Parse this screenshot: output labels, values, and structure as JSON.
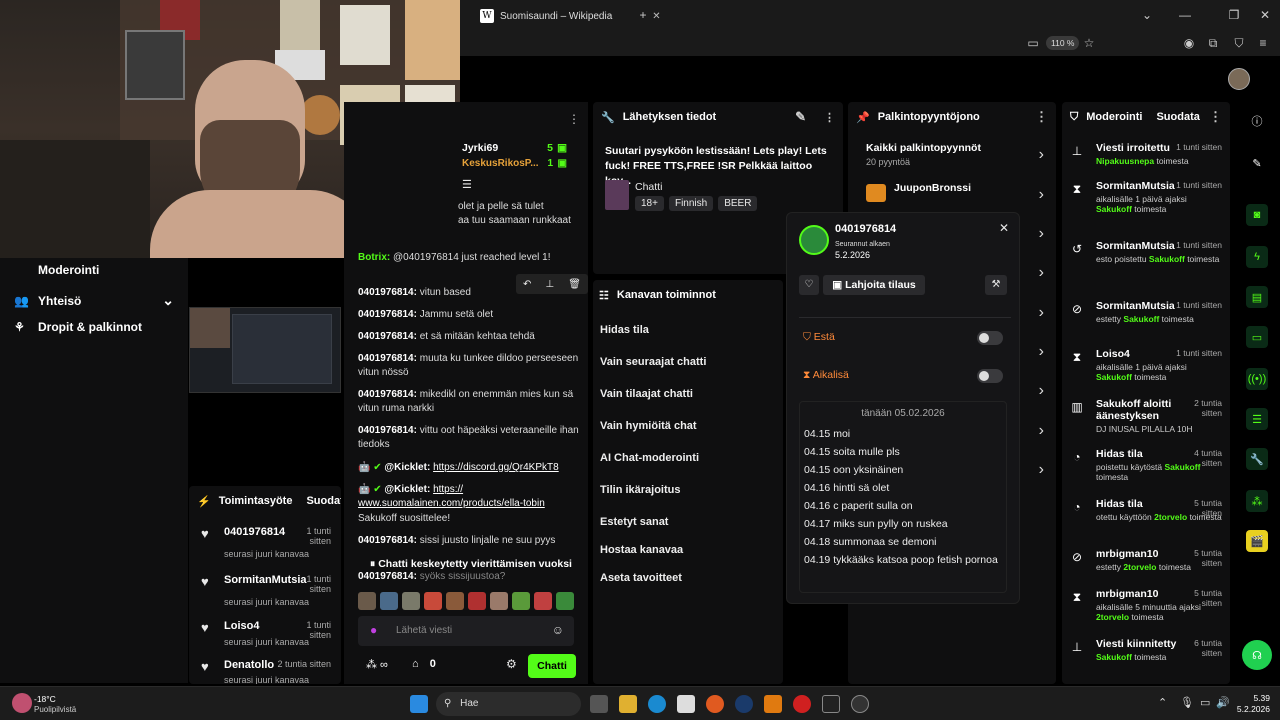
{
  "browser": {
    "tab_title": "Suomisaundi – Wikipedia",
    "zoom": "110 %"
  },
  "left_nav": {
    "items": [
      {
        "label": "Moderointi"
      },
      {
        "label": "Yhteisö"
      },
      {
        "label": "Dropit & palkinnot"
      }
    ]
  },
  "chat": {
    "top_users": [
      {
        "name": "Jyrki69",
        "count": "5"
      },
      {
        "name": "KeskusRikosP...",
        "count": "1"
      }
    ],
    "messages": [
      {
        "user": "",
        "text": "olet ja pelle sä tulet"
      },
      {
        "user": "",
        "text": "aa tuu saamaan runkkaat"
      },
      {
        "user": "Botrix:",
        "text": "@0401976814 just reached level 1!"
      },
      {
        "user": "0401976814:",
        "text": "vitun based"
      },
      {
        "user": "0401976814:",
        "text": "Jammu setä olet"
      },
      {
        "user": "0401976814:",
        "text": "et sä mitään kehtaa tehdä"
      },
      {
        "user": "0401976814:",
        "text": "muuta ku tunkee dildoo perseeseen vitun nössö"
      },
      {
        "user": "0401976814:",
        "text": "mikedikl on enemmän mies kun sä vitun ruma narkki"
      },
      {
        "user": "0401976814:",
        "text": "vittu oot häpeäksi veteraaneille ihan tiedoks"
      },
      {
        "user": "@Kicklet:",
        "text": "https://discord.gg/Qr4KPkT8"
      },
      {
        "user": "@Kicklet:",
        "text": "https:// www.suomalainen.com/products/ella-tobin"
      },
      {
        "user": "",
        "text": "Sakukoff suosittelee!"
      },
      {
        "user": "0401976814:",
        "text": "sissi juusto linjalle ne suu pyys"
      },
      {
        "user": "0401976814:",
        "text": "syöks sissijuustoa?"
      }
    ],
    "paused_banner": "Chatti keskeytetty vierittämisen vuoksi",
    "input_placeholder": "Lähetä viesti",
    "gift_count": "0",
    "send_label": "Chatti"
  },
  "stream_info": {
    "title": "Lähetyksen tiedot",
    "stream_title": "Suutari pysyköön lestissään! Lets play! Lets fuck! FREE TTS,FREE !SR Pelkkää laittoo kov...",
    "category": "Chatti",
    "tags": [
      "18+",
      "Finnish",
      "BEER"
    ]
  },
  "channel_actions": {
    "title": "Kanavan toiminnot",
    "items": [
      "Hidas tila",
      "Vain seuraajat chatti",
      "Vain tilaajat chatti",
      "Vain hymiöitä chat",
      "AI Chat-moderointi",
      "Tilin ikärajoitus",
      "Estetyt sanat",
      "Hostaa kanavaa",
      "Aseta tavoitteet"
    ]
  },
  "rewards": {
    "title": "Palkintopyyntöjono",
    "all_label": "Kaikki palkintopyynnöt",
    "all_count": "20 pyyntöä",
    "first_reward": "JuuponBronssi"
  },
  "user_card": {
    "username": "0401976814",
    "followed_label": "Seurannut alkaen",
    "followed_date": "5.2.2026",
    "gift_label": "Lahjoita tilaus",
    "block_label": "Estä",
    "timeout_label": "Aikalisä",
    "date_divider": "tänään 05.02.2026",
    "history": [
      {
        "time": "04.15",
        "text": "moi"
      },
      {
        "time": "04.15",
        "text": "soita mulle pls"
      },
      {
        "time": "04.15",
        "text": "oon yksinäinen"
      },
      {
        "time": "04.16",
        "text": "hintti sä olet"
      },
      {
        "time": "04.16",
        "text": "c paperit sulla on"
      },
      {
        "time": "04.17",
        "text": "miks sun pylly on ruskea"
      },
      {
        "time": "04.18",
        "text": "summonaa se demoni"
      },
      {
        "time": "04.19",
        "text": "tykkääks katsoa poop fetish pornoa"
      }
    ]
  },
  "activity": {
    "title": "Toimintasyöte",
    "action": "Suodata",
    "items": [
      {
        "name": "0401976814",
        "time": "1 tunti sitten",
        "desc": "seurasi juuri kanavaa"
      },
      {
        "name": "SormitanMutsia",
        "time": "1 tunti sitten",
        "desc": "seurasi juuri kanavaa"
      },
      {
        "name": "Loiso4",
        "time": "1 tunti sitten",
        "desc": "seurasi juuri kanavaa"
      },
      {
        "name": "Denatollo",
        "time": "2 tuntia sitten",
        "desc": "seurasi juuri kanavaa"
      }
    ]
  },
  "mod_log": {
    "title": "Moderointi",
    "filter": "Suodata",
    "items": [
      {
        "icon": "unpin-icon",
        "name": "Viesti irroitettu",
        "time": "1 tunti sitten",
        "pre": "",
        "actor": "Nipakuusnepa",
        "post": " toimesta"
      },
      {
        "icon": "hourglass-icon",
        "name": "SormitanMutsia",
        "time": "1 tunti sitten",
        "pre": "aikalisälle 1 päivä ajaksi ",
        "actor": "Sakukoff",
        "post": " toimesta"
      },
      {
        "icon": "undo-icon",
        "name": "SormitanMutsia",
        "time": "1 tunti sitten",
        "pre": "esto poistettu ",
        "actor": "Sakukoff",
        "post": " toimesta"
      },
      {
        "icon": "ban-icon",
        "name": "SormitanMutsia",
        "time": "1 tunti sitten",
        "pre": "estetty ",
        "actor": "Sakukoff",
        "post": " toimesta"
      },
      {
        "icon": "hourglass-icon",
        "name": "Loiso4",
        "time": "1 tunti sitten",
        "pre": "aikalisälle 1 päivä ajaksi ",
        "actor": "Sakukoff",
        "post": " toimesta"
      },
      {
        "icon": "poll-icon",
        "name": "Sakukoff aloitti äänestyksen",
        "time": "2 tuntia sitten",
        "pre": "DJ INUSAL PILALLA 10H",
        "actor": "",
        "post": ""
      },
      {
        "icon": "slow-icon",
        "name": "Hidas tila",
        "time": "4 tuntia sitten",
        "pre": "poistettu käytöstä ",
        "actor": "Sakukoff",
        "post": " toimesta"
      },
      {
        "icon": "slow-icon",
        "name": "Hidas tila",
        "time": "5 tuntia sitten",
        "pre": "otettu käyttöön ",
        "actor": "2torvelo",
        "post": " toimesta"
      },
      {
        "icon": "ban-icon",
        "name": "mrbigman10",
        "time": "5 tuntia sitten",
        "pre": "estetty ",
        "actor": "2torvelo",
        "post": " toimesta"
      },
      {
        "icon": "hourglass-icon",
        "name": "mrbigman10",
        "time": "5 tuntia sitten",
        "pre": "aikalisälle 5 minuuttia ajaksi ",
        "actor": "2torvelo",
        "post": " toimesta"
      },
      {
        "icon": "pin-icon",
        "name": "Viesti kiinnitetty",
        "time": "6 tuntia sitten",
        "pre": "",
        "actor": "Sakukoff",
        "post": " toimesta"
      }
    ]
  },
  "taskbar": {
    "weather_temp": "-18°C",
    "weather_desc": "Puolipilvistä",
    "search_label": "Hae",
    "clock_time": "5.39",
    "clock_date": "5.2.2026"
  }
}
